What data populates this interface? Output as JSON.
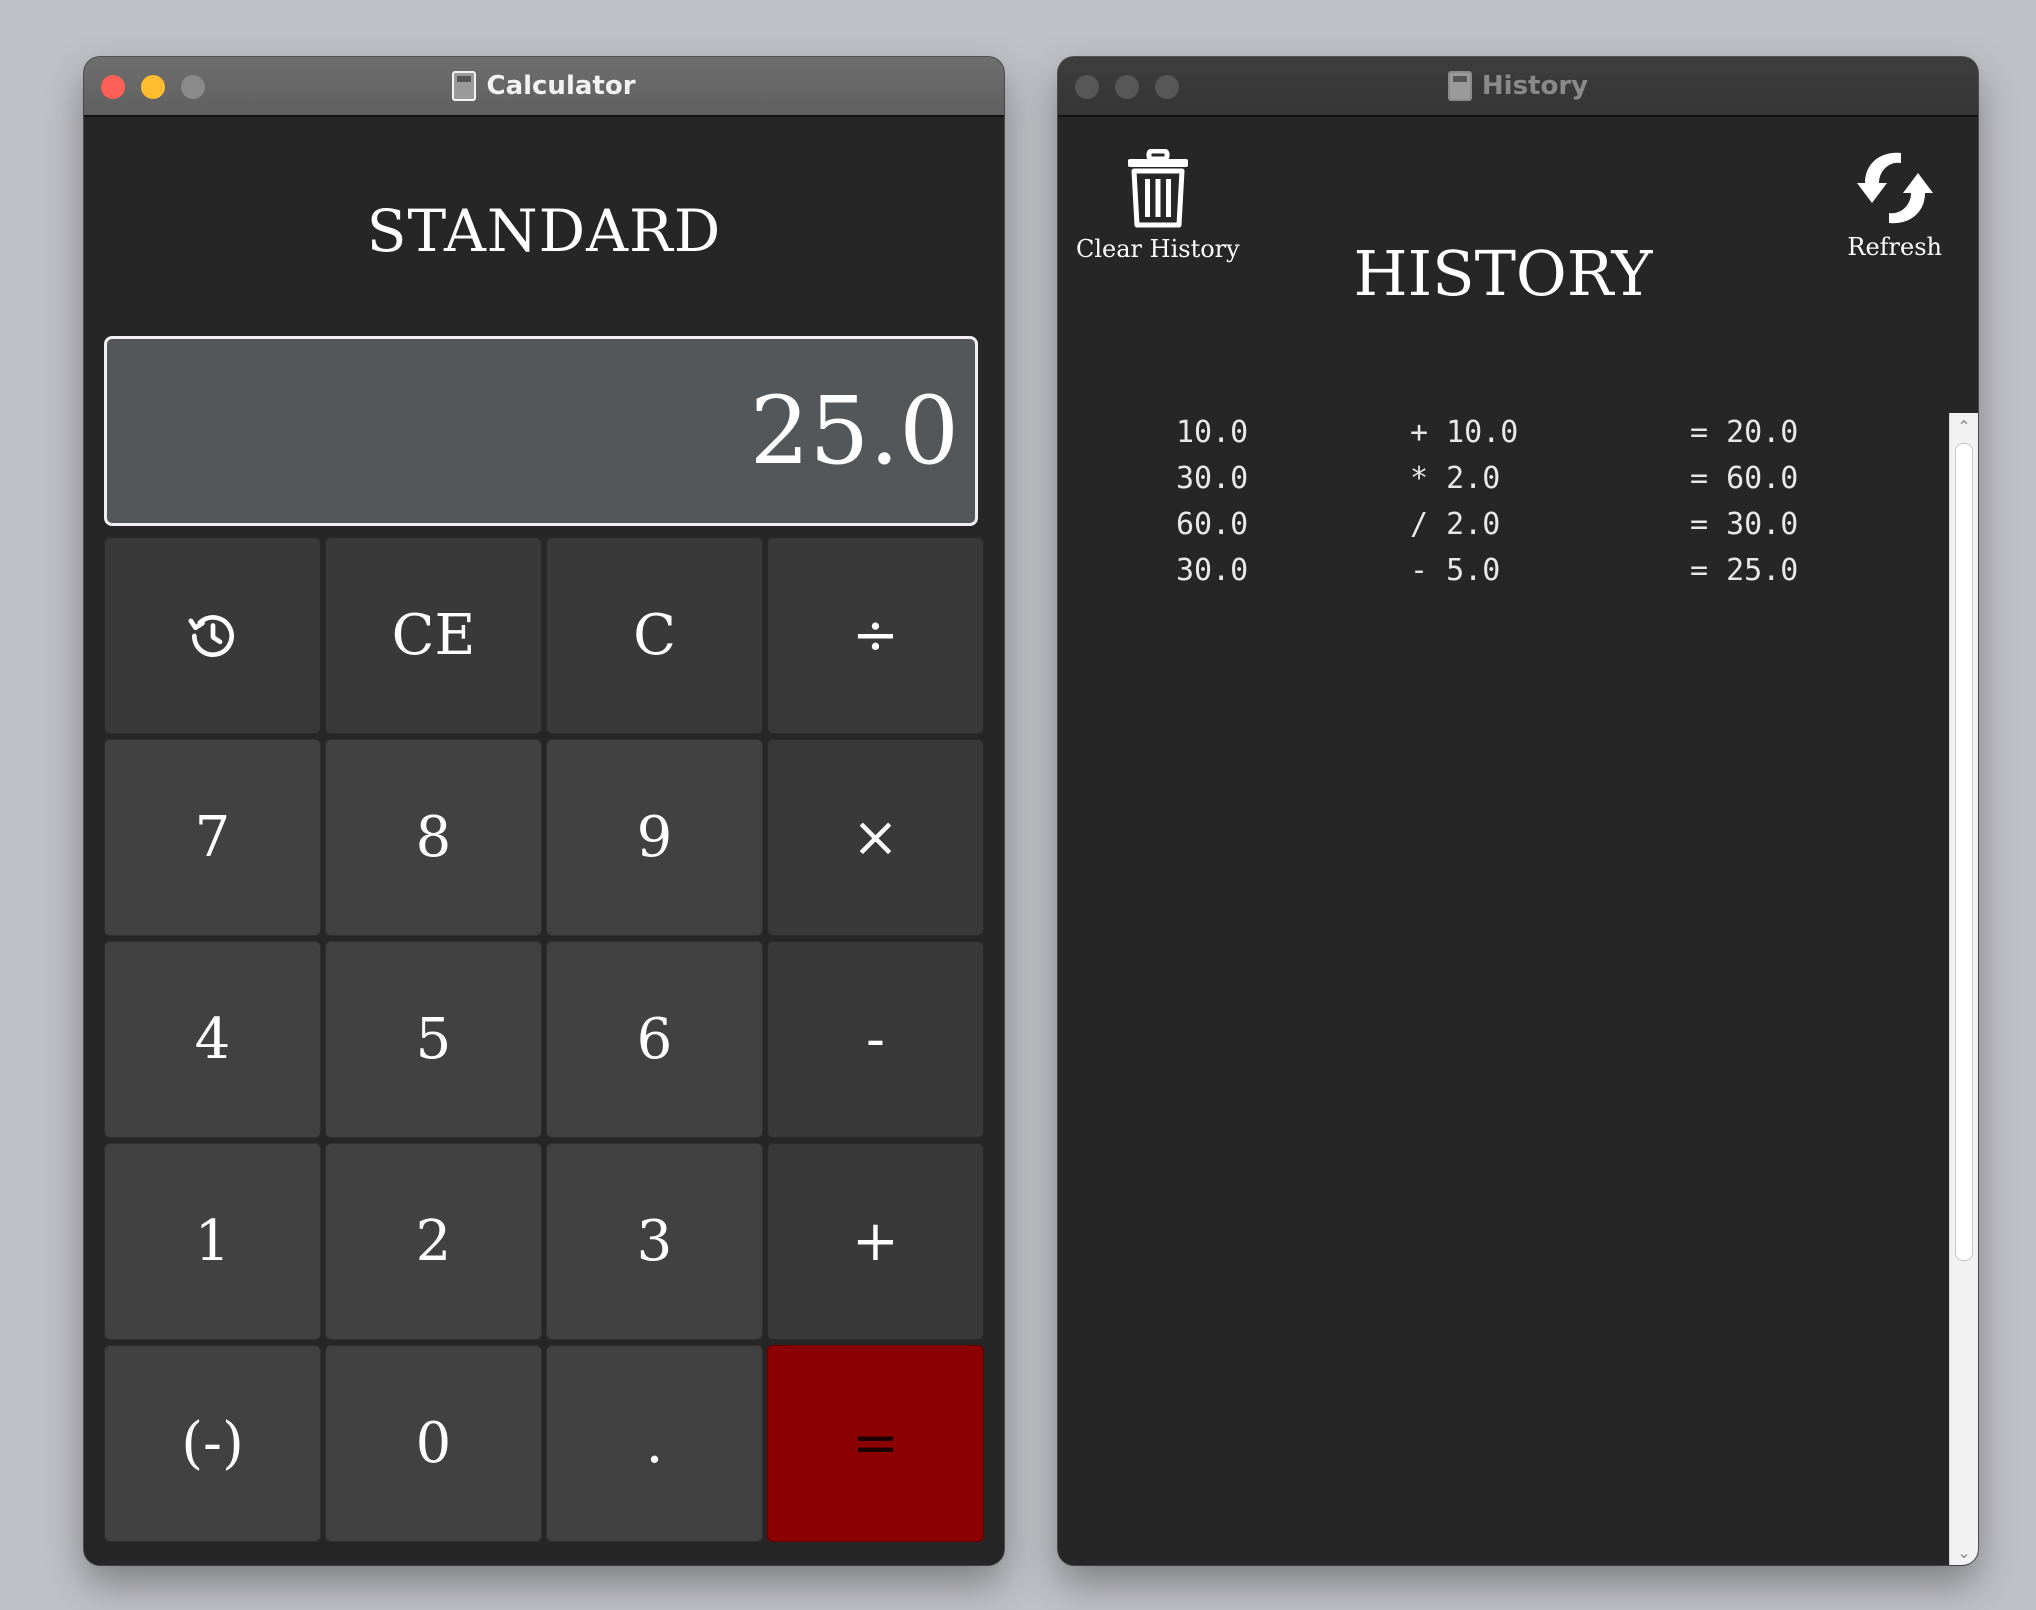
{
  "calculator_window": {
    "title": "Calculator",
    "traffic_colors": {
      "close": "#fe5f57",
      "minimize": "#febc2e",
      "zoom": "#8a8a8a"
    },
    "mode": "STANDARD",
    "display_value": "25.0",
    "keys": {
      "history": "history-icon",
      "ce": "CE",
      "c": "C",
      "divide": "÷",
      "seven": "7",
      "eight": "8",
      "nine": "9",
      "multiply": "×",
      "four": "4",
      "five": "5",
      "six": "6",
      "subtract": "-",
      "one": "1",
      "two": "2",
      "three": "3",
      "add": "+",
      "negate": "(-)",
      "zero": "0",
      "decimal": ".",
      "equals": "="
    },
    "equals_color": "#8b0000"
  },
  "history_window": {
    "title": "History",
    "heading": "HISTORY",
    "clear_label": "Clear History",
    "refresh_label": "Refresh",
    "entries": [
      {
        "operand": "10.0",
        "operation": "+ 10.0",
        "result": "= 20.0"
      },
      {
        "operand": "30.0",
        "operation": "* 2.0",
        "result": "= 60.0"
      },
      {
        "operand": "60.0",
        "operation": "/ 2.0",
        "result": "= 30.0"
      },
      {
        "operand": "30.0",
        "operation": "- 5.0",
        "result": "= 25.0"
      }
    ]
  }
}
